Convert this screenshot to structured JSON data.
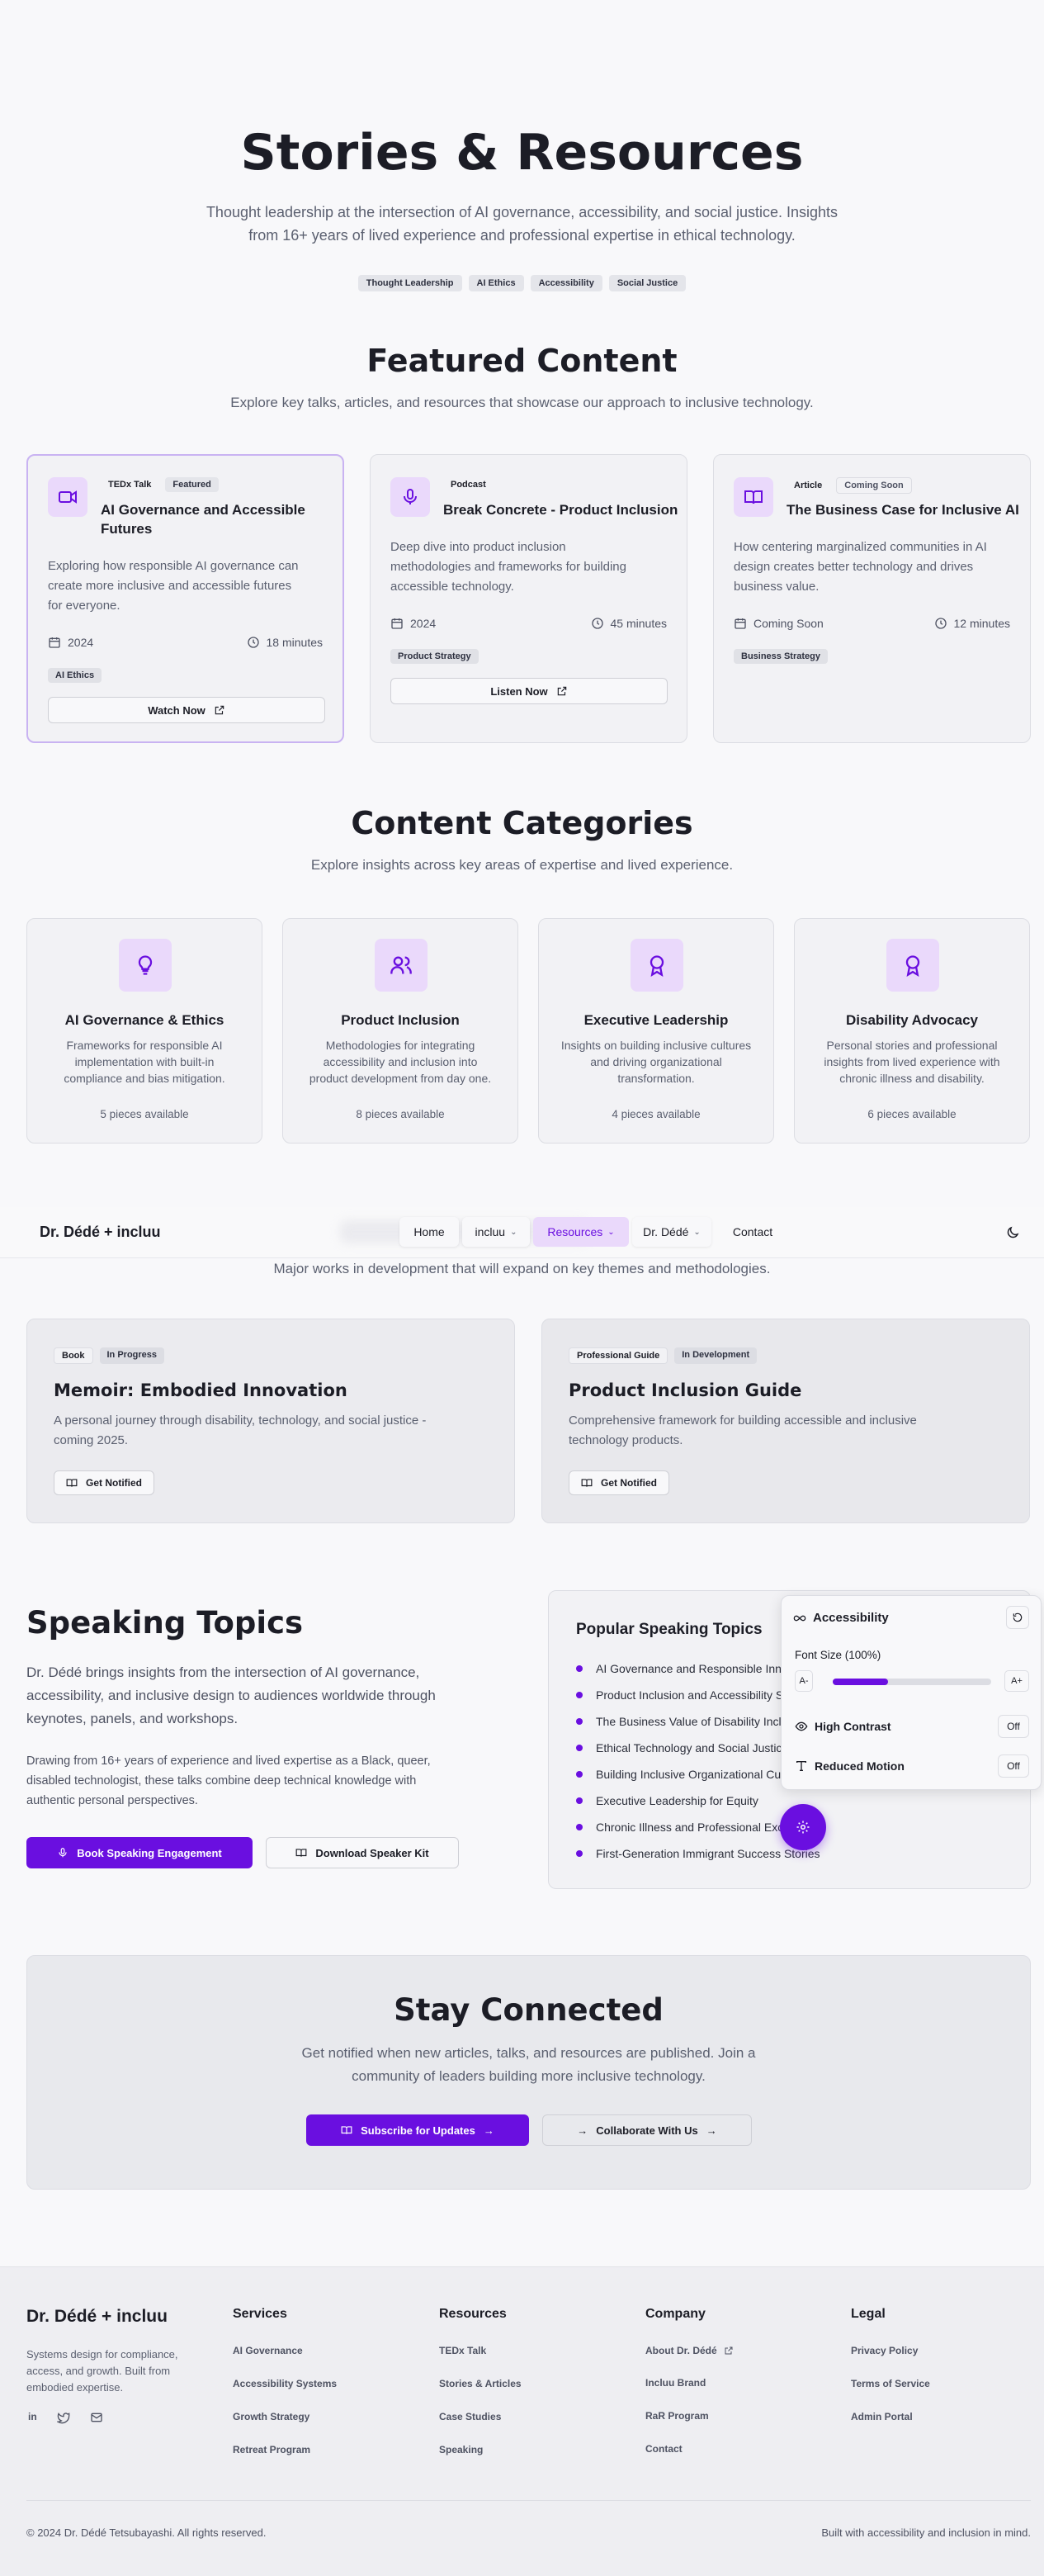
{
  "hero": {
    "title": "Stories & Resources",
    "subtitle_line1": "Thought leadership at the intersection of AI governance, accessibility, and social justice. Insights",
    "subtitle_line2": "from 16+ years of lived experience and professional expertise in ethical technology.",
    "tags": [
      "Thought Leadership",
      "AI Ethics",
      "Accessibility",
      "Social Justice"
    ]
  },
  "featured": {
    "title": "Featured Content",
    "subtitle": "Explore key talks, articles, and resources that showcase our approach to inclusive technology.",
    "cards": [
      {
        "icon": "video-icon",
        "type": "TEDx Talk",
        "badge": "Featured",
        "title_line1": "AI Governance and Accessible",
        "title_line2": "Futures",
        "desc_line1": "Exploring how responsible AI governance can",
        "desc_line2": "create more inclusive and accessible futures",
        "desc_line3": "for everyone.",
        "year": "2024",
        "duration": "18 minutes",
        "tag": "AI Ethics",
        "action": "Watch Now"
      },
      {
        "icon": "microphone-icon",
        "type": "Podcast",
        "badge": "",
        "title_line1": "Break Concrete - Product Inclusion",
        "title_line2": "",
        "desc_line1": "Deep dive into product inclusion",
        "desc_line2": "methodologies and frameworks for building",
        "desc_line3": "accessible technology.",
        "year": "2024",
        "duration": "45 minutes",
        "tag": "Product Strategy",
        "action": "Listen Now"
      },
      {
        "icon": "book-open-icon",
        "type": "Article",
        "badge": "Coming Soon",
        "title_line1": "The Business Case for Inclusive AI",
        "title_line2": "",
        "desc_line1": "How centering marginalized communities in AI",
        "desc_line2": "design creates better technology and drives",
        "desc_line3": "business value.",
        "year": "Coming Soon",
        "duration": "12 minutes",
        "tag": "Business Strategy",
        "action": ""
      }
    ]
  },
  "categories": {
    "title": "Content Categories",
    "subtitle": "Explore insights across key areas of expertise and lived experience.",
    "items": [
      {
        "icon": "lightbulb-icon",
        "title": "AI Governance & Ethics",
        "d1": "Frameworks for responsible AI",
        "d2": "implementation with built-in",
        "d3": "compliance and bias mitigation.",
        "count": "5 pieces available"
      },
      {
        "icon": "users-icon",
        "title": "Product Inclusion",
        "d1": "Methodologies for integrating",
        "d2": "accessibility and inclusion into",
        "d3": "product development from day one.",
        "count": "8 pieces available"
      },
      {
        "icon": "award-icon",
        "title": "Executive Leadership",
        "d1": "Insights on building inclusive cultures",
        "d2": "and driving organizational",
        "d3": "transformation.",
        "count": "4 pieces available"
      },
      {
        "icon": "award-icon",
        "title": "Disability Advocacy",
        "d1": "Personal stories and professional",
        "d2": "insights from lived experience with",
        "d3": "chronic illness and disability.",
        "count": "6 pieces available"
      }
    ]
  },
  "nav": {
    "brand": "Dr. Dédé + incluu",
    "items": [
      "Home",
      "incluu",
      "Resources",
      "Dr. Dédé",
      "Contact"
    ],
    "active": "Resources",
    "theme_icon": "moon-icon"
  },
  "upcoming": {
    "subtitle": "Major works in development that will expand on key themes and methodologies.",
    "cards": [
      {
        "type": "Book",
        "status": "In Progress",
        "title": "Memoir: Embodied Innovation",
        "d1": "A personal journey through disability, technology, and social justice -",
        "d2": "coming 2025.",
        "action": "Get Notified"
      },
      {
        "type": "Professional Guide",
        "status": "In Development",
        "title": "Product Inclusion Guide",
        "d1": "Comprehensive framework for building accessible and inclusive",
        "d2": "technology products.",
        "action": "Get Notified"
      }
    ]
  },
  "speaking": {
    "title": "Speaking Topics",
    "p1_l1": "Dr. Dédé brings insights from the intersection of AI governance,",
    "p1_l2": "accessibility, and inclusive design to audiences worldwide through",
    "p1_l3": "keynotes, panels, and workshops.",
    "p2_l1": "Drawing from 16+ years of experience and lived expertise as a Black, queer,",
    "p2_l2": "disabled technologist, these talks combine deep technical knowledge with",
    "p2_l3": "authentic personal perspectives.",
    "book_btn": "Book Speaking Engagement",
    "kit_btn": "Download Speaker Kit",
    "popular_title": "Popular Speaking Topics",
    "topics": [
      "AI Governance and Responsible Inno",
      "Product Inclusion and Accessibility S",
      "The Business Value of Disability Inclu",
      "Ethical Technology and Social Justic",
      "Building Inclusive Organizational Cul",
      "Executive Leadership for Equity",
      "Chronic Illness and Professional Exc",
      "First-Generation Immigrant Success Stories"
    ]
  },
  "a11y": {
    "title": "Accessibility",
    "font_size_label": "Font Size (100%)",
    "font_level": 0.35,
    "decrease": "A-",
    "increase": "A+",
    "high_contrast": "High Contrast",
    "high_contrast_value": "Off",
    "reduced_motion": "Reduced Motion",
    "reduced_motion_value": "Off"
  },
  "connect": {
    "title": "Stay Connected",
    "l1": "Get notified when new articles, talks, and resources are published. Join a",
    "l2": "community of leaders building more inclusive technology.",
    "subscribe": "Subscribe for Updates",
    "collab": "Collaborate With Us"
  },
  "footer": {
    "brand": "Dr. Dédé + incluu",
    "blurb_l1": "Systems design for compliance,",
    "blurb_l2": "access, and growth. Built from",
    "blurb_l3": "embodied expertise.",
    "columns": [
      {
        "heading": "Services",
        "links": [
          "AI Governance",
          "Accessibility Systems",
          "Growth Strategy",
          "Retreat Program"
        ]
      },
      {
        "heading": "Resources",
        "links": [
          "TEDx Talk",
          "Stories & Articles",
          "Case Studies",
          "Speaking"
        ]
      },
      {
        "heading": "Company",
        "links": [
          "About Dr. Dédé",
          "Incluu Brand",
          "RaR Program",
          "Contact"
        ]
      },
      {
        "heading": "Legal",
        "links": [
          "Privacy Policy",
          "Terms of Service",
          "Admin Portal"
        ]
      }
    ],
    "copyright": "© 2024 Dr. Dédé Tetsubayashi. All rights reserved.",
    "built": "Built with accessibility and inclusion in mind."
  },
  "colors": {
    "accent": "#6a0fe0",
    "accent_light": "#ead9fb",
    "background": "#f8f8fa"
  }
}
